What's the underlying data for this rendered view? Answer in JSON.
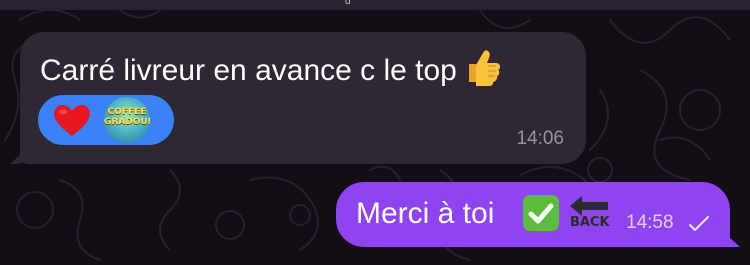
{
  "header": {
    "partial_text": "g"
  },
  "messages": [
    {
      "direction": "incoming",
      "text": "Carré livreur en avance c le top",
      "emoji": "thumbs-up-icon",
      "time": "14:06",
      "reactions": [
        {
          "icon": "red-heart-icon"
        },
        {
          "icon": "sticker-avatar",
          "label": "COFFEE GRADOUILLE"
        }
      ]
    },
    {
      "direction": "outgoing",
      "text": "Merci à toi",
      "emoji": "check-mark-button-icon",
      "sticker_label": "BACK",
      "time": "14:58",
      "status": "read-check-icon"
    }
  ],
  "colors": {
    "background": "#140d16",
    "incoming_bubble": "#2f2733",
    "outgoing_bubble": "#8f44f2",
    "reaction_pill": "#3b82f6"
  }
}
